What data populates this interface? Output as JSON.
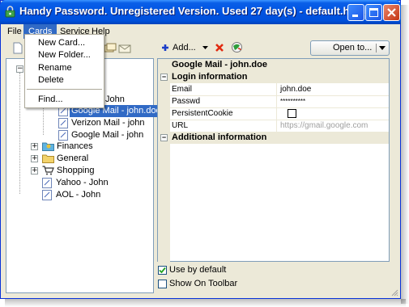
{
  "window": {
    "title": "Handy Password. Unregistered Version. Used 27 day(s) - default.hp..."
  },
  "menubar": {
    "items": [
      "File",
      "Cards",
      "Service",
      "Help"
    ],
    "active": "Cards"
  },
  "cards_menu": {
    "items": [
      "New Card...",
      "New Folder...",
      "Rename",
      "Delete",
      "Find..."
    ]
  },
  "toolbar": {
    "add_label": "Add...",
    "open_label": "Open to..."
  },
  "tree": {
    "partial_item": "John",
    "items": [
      {
        "label": "Google Mail - john.doe",
        "selected": true
      },
      {
        "label": "Verizon Mail - john"
      },
      {
        "label": "Google Mail - john"
      }
    ],
    "folders": [
      {
        "label": "Finances"
      },
      {
        "label": "General"
      },
      {
        "label": "Shopping"
      }
    ],
    "root_items": [
      {
        "label": "Yahoo - John"
      },
      {
        "label": "AOL - John"
      }
    ]
  },
  "card": {
    "title": "Google Mail - john.doe",
    "login_section": "Login information",
    "fields": [
      {
        "key": "Email",
        "value": "john.doe"
      },
      {
        "key": "Passwd",
        "value": "**********"
      },
      {
        "key": "PersistentCookie",
        "value": ""
      },
      {
        "key": "URL",
        "value": "https://gmail.google.com"
      }
    ],
    "additional_section": "Additional information"
  },
  "options": {
    "use_by_default": "Use by default",
    "show_on_toolbar": "Show On Toolbar"
  },
  "colors": {
    "selection": "#316ac5",
    "title_bar": "#0053e1"
  }
}
